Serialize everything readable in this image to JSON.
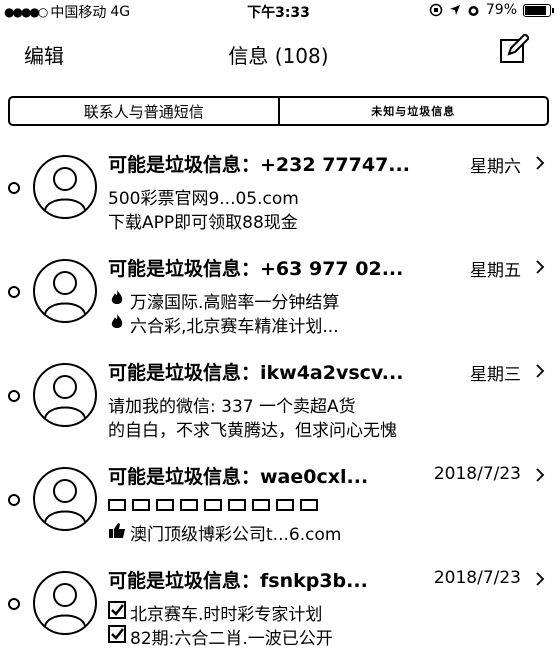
{
  "status_bar": {
    "carrier": "中国移动",
    "network": "4G",
    "time": "下午3:33",
    "battery": "79%",
    "battery_level": 0.79
  },
  "nav": {
    "edit": "编辑",
    "title": "信息 (108)"
  },
  "segments": [
    "联系人与普通短信",
    "未知与垃圾信息"
  ],
  "messages": [
    {
      "title": "可能是垃圾信息：+232 77747...",
      "date": "星期六",
      "line1": "500彩票官网9...05.com",
      "line2": "下载APP即可领取88现金",
      "icon1": "",
      "icon2": ""
    },
    {
      "title": "可能是垃圾信息：+63 977 02...",
      "date": "星期五",
      "line1": "万濠国际.高赔率一分钟结算",
      "line2": "六合彩,北京赛车精准计划...",
      "icon1": "fire-icon",
      "icon2": "fire-icon"
    },
    {
      "title": "可能是垃圾信息：ikw4a2vscv...",
      "date": "星期三",
      "line1": "请加我的微信: 337       一个卖超A货",
      "line2": "的自白，不求飞黄腾达，但求问心无愧",
      "icon1": "",
      "icon2": ""
    },
    {
      "title": "可能是垃圾信息：wae0cxl...",
      "date": "2018/7/23",
      "line1": "",
      "line2": "澳门顶级博彩公司t...6.com",
      "icon1": "boxes",
      "icon2": "thumb-icon"
    },
    {
      "title": "可能是垃圾信息：fsnkp3b...",
      "date": "2018/7/23",
      "line1": "北京赛车.时时彩专家计划",
      "line2": "82期:六合二肖.一波已公开",
      "icon1": "checkbox-icon",
      "icon2": "checkbox-icon"
    }
  ]
}
